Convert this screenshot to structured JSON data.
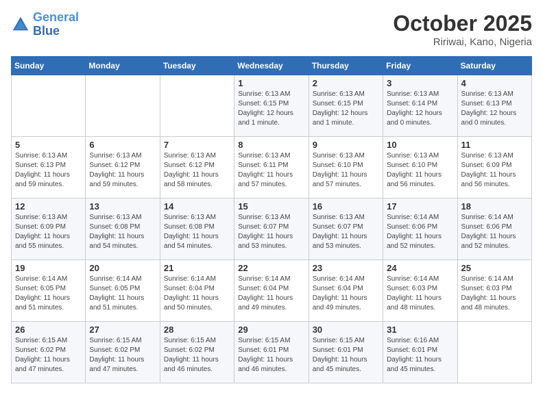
{
  "header": {
    "logo_line1": "General",
    "logo_line2": "Blue",
    "month": "October 2025",
    "location": "Ririwai, Kano, Nigeria"
  },
  "weekdays": [
    "Sunday",
    "Monday",
    "Tuesday",
    "Wednesday",
    "Thursday",
    "Friday",
    "Saturday"
  ],
  "weeks": [
    [
      {
        "day": "",
        "info": ""
      },
      {
        "day": "",
        "info": ""
      },
      {
        "day": "",
        "info": ""
      },
      {
        "day": "1",
        "info": "Sunrise: 6:13 AM\nSunset: 6:15 PM\nDaylight: 12 hours\nand 1 minute."
      },
      {
        "day": "2",
        "info": "Sunrise: 6:13 AM\nSunset: 6:15 PM\nDaylight: 12 hours\nand 1 minute."
      },
      {
        "day": "3",
        "info": "Sunrise: 6:13 AM\nSunset: 6:14 PM\nDaylight: 12 hours\nand 0 minutes."
      },
      {
        "day": "4",
        "info": "Sunrise: 6:13 AM\nSunset: 6:13 PM\nDaylight: 12 hours\nand 0 minutes."
      }
    ],
    [
      {
        "day": "5",
        "info": "Sunrise: 6:13 AM\nSunset: 6:13 PM\nDaylight: 11 hours\nand 59 minutes."
      },
      {
        "day": "6",
        "info": "Sunrise: 6:13 AM\nSunset: 6:12 PM\nDaylight: 11 hours\nand 59 minutes."
      },
      {
        "day": "7",
        "info": "Sunrise: 6:13 AM\nSunset: 6:12 PM\nDaylight: 11 hours\nand 58 minutes."
      },
      {
        "day": "8",
        "info": "Sunrise: 6:13 AM\nSunset: 6:11 PM\nDaylight: 11 hours\nand 57 minutes."
      },
      {
        "day": "9",
        "info": "Sunrise: 6:13 AM\nSunset: 6:10 PM\nDaylight: 11 hours\nand 57 minutes."
      },
      {
        "day": "10",
        "info": "Sunrise: 6:13 AM\nSunset: 6:10 PM\nDaylight: 11 hours\nand 56 minutes."
      },
      {
        "day": "11",
        "info": "Sunrise: 6:13 AM\nSunset: 6:09 PM\nDaylight: 11 hours\nand 56 minutes."
      }
    ],
    [
      {
        "day": "12",
        "info": "Sunrise: 6:13 AM\nSunset: 6:09 PM\nDaylight: 11 hours\nand 55 minutes."
      },
      {
        "day": "13",
        "info": "Sunrise: 6:13 AM\nSunset: 6:08 PM\nDaylight: 11 hours\nand 54 minutes."
      },
      {
        "day": "14",
        "info": "Sunrise: 6:13 AM\nSunset: 6:08 PM\nDaylight: 11 hours\nand 54 minutes."
      },
      {
        "day": "15",
        "info": "Sunrise: 6:13 AM\nSunset: 6:07 PM\nDaylight: 11 hours\nand 53 minutes."
      },
      {
        "day": "16",
        "info": "Sunrise: 6:13 AM\nSunset: 6:07 PM\nDaylight: 11 hours\nand 53 minutes."
      },
      {
        "day": "17",
        "info": "Sunrise: 6:14 AM\nSunset: 6:06 PM\nDaylight: 11 hours\nand 52 minutes."
      },
      {
        "day": "18",
        "info": "Sunrise: 6:14 AM\nSunset: 6:06 PM\nDaylight: 11 hours\nand 52 minutes."
      }
    ],
    [
      {
        "day": "19",
        "info": "Sunrise: 6:14 AM\nSunset: 6:05 PM\nDaylight: 11 hours\nand 51 minutes."
      },
      {
        "day": "20",
        "info": "Sunrise: 6:14 AM\nSunset: 6:05 PM\nDaylight: 11 hours\nand 51 minutes."
      },
      {
        "day": "21",
        "info": "Sunrise: 6:14 AM\nSunset: 6:04 PM\nDaylight: 11 hours\nand 50 minutes."
      },
      {
        "day": "22",
        "info": "Sunrise: 6:14 AM\nSunset: 6:04 PM\nDaylight: 11 hours\nand 49 minutes."
      },
      {
        "day": "23",
        "info": "Sunrise: 6:14 AM\nSunset: 6:04 PM\nDaylight: 11 hours\nand 49 minutes."
      },
      {
        "day": "24",
        "info": "Sunrise: 6:14 AM\nSunset: 6:03 PM\nDaylight: 11 hours\nand 48 minutes."
      },
      {
        "day": "25",
        "info": "Sunrise: 6:14 AM\nSunset: 6:03 PM\nDaylight: 11 hours\nand 48 minutes."
      }
    ],
    [
      {
        "day": "26",
        "info": "Sunrise: 6:15 AM\nSunset: 6:02 PM\nDaylight: 11 hours\nand 47 minutes."
      },
      {
        "day": "27",
        "info": "Sunrise: 6:15 AM\nSunset: 6:02 PM\nDaylight: 11 hours\nand 47 minutes."
      },
      {
        "day": "28",
        "info": "Sunrise: 6:15 AM\nSunset: 6:02 PM\nDaylight: 11 hours\nand 46 minutes."
      },
      {
        "day": "29",
        "info": "Sunrise: 6:15 AM\nSunset: 6:01 PM\nDaylight: 11 hours\nand 46 minutes."
      },
      {
        "day": "30",
        "info": "Sunrise: 6:15 AM\nSunset: 6:01 PM\nDaylight: 11 hours\nand 45 minutes."
      },
      {
        "day": "31",
        "info": "Sunrise: 6:16 AM\nSunset: 6:01 PM\nDaylight: 11 hours\nand 45 minutes."
      },
      {
        "day": "",
        "info": ""
      }
    ]
  ]
}
